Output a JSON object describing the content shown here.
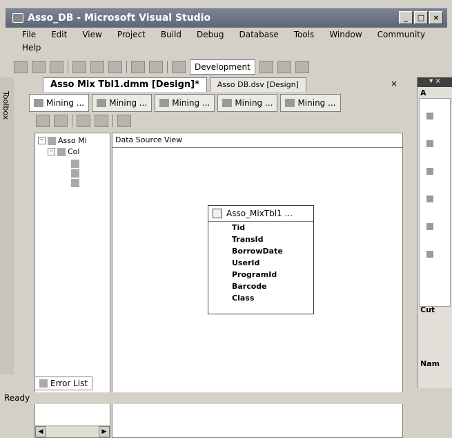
{
  "window": {
    "title": "Asso_DB - Microsoft Visual Studio",
    "minimize": "_",
    "maximize": "□",
    "close": "×"
  },
  "menu": {
    "row1": [
      "File",
      "Edit",
      "View",
      "Project",
      "Build",
      "Debug",
      "Database",
      "Tools",
      "Window",
      "Community"
    ],
    "row2": [
      "Help"
    ]
  },
  "toolbar": {
    "config": "Development"
  },
  "toolbox": {
    "label": "Toolbox"
  },
  "doctabs": {
    "active": "Asso Mix Tbl1.dmm [Design]*",
    "other": "Asso DB.dsv [Design]",
    "close": "×"
  },
  "subtabs": [
    "Mining ...",
    "Mining ...",
    "Mining ...",
    "Mining ...",
    "Mining ..."
  ],
  "tree": {
    "root": "Asso Mi",
    "child": "Col"
  },
  "dsv": {
    "header": "Data Source View"
  },
  "table": {
    "name": "Asso_MixTbl1 ...",
    "columns": [
      "Tid",
      "TransId",
      "BorrowDate",
      "UserId",
      "ProgramId",
      "Barcode",
      "Class"
    ]
  },
  "bottom": {
    "error_list": "Error List",
    "status": "Ready"
  },
  "right_pane": {
    "label1": "A",
    "cut": "Cut",
    "nam": "Nam"
  }
}
